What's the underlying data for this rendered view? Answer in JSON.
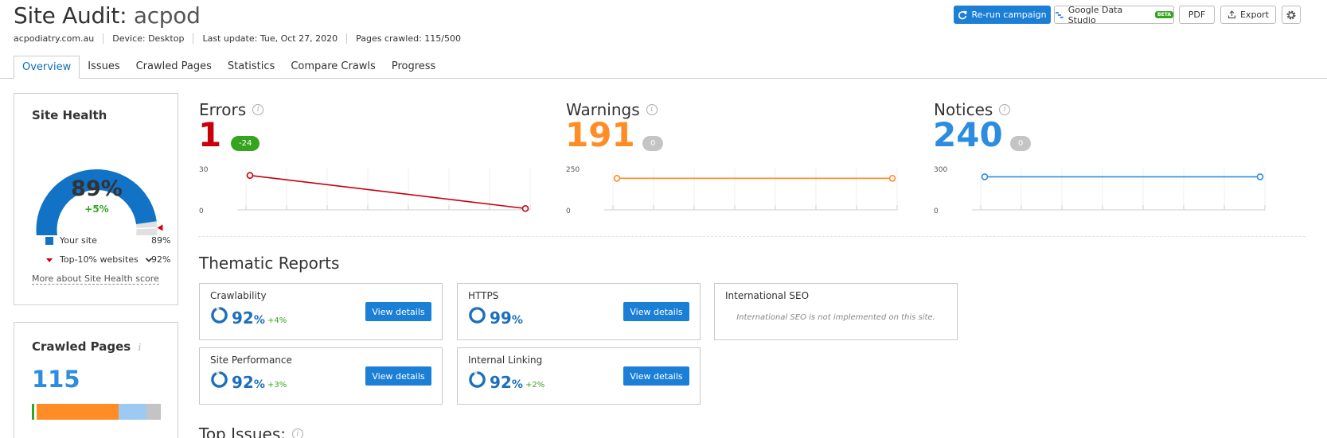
{
  "header": {
    "title": "Site Audit:",
    "project": "acpod",
    "meta": [
      "acpodiatry.com.au",
      "Device: Desktop",
      "Last update: Tue, Oct 27, 2020",
      "Pages crawled: 115/500"
    ]
  },
  "toolbar": {
    "rerun_label": "Re-run campaign",
    "gds_label": "Google Data Studio",
    "beta_label": "BETA",
    "pdf_label": "PDF",
    "export_label": "Export"
  },
  "tabs": [
    "Overview",
    "Issues",
    "Crawled Pages",
    "Statistics",
    "Compare Crawls",
    "Progress"
  ],
  "site_health": {
    "title": "Site Health",
    "value": "89%",
    "change": "+5%",
    "fraction": 0.89,
    "top10_fraction": 0.92,
    "legend": [
      {
        "label": "Your site",
        "value": "89%",
        "color": "#1172c6"
      },
      {
        "label": "Top-10% websites",
        "value": "92%",
        "color": "#d6000c"
      }
    ],
    "more_link": "More about Site Health score"
  },
  "crawled_pages": {
    "title": "Crawled Pages",
    "value": "115",
    "segments": [
      {
        "fraction": 0.02,
        "color": "#36a420"
      },
      {
        "fraction": 0.02,
        "color": "#ffffff"
      },
      {
        "fraction": 0.63,
        "color": "#ff8c25"
      },
      {
        "fraction": 0.22,
        "color": "#9dcaf2"
      },
      {
        "fraction": 0.11,
        "color": "#c4c4c4"
      }
    ]
  },
  "metrics": [
    {
      "name": "Errors",
      "value": "1",
      "badge": "-24",
      "color": "#c7000c",
      "badge_color": "#36a420",
      "ymax": "30",
      "ymin": "0",
      "ymax_num": 30,
      "points": [
        25,
        1
      ]
    },
    {
      "name": "Warnings",
      "value": "191",
      "badge": "0",
      "color": "#ff8c25",
      "badge_color": "#c4c4c4",
      "ymax": "250",
      "ymin": "0",
      "ymax_num": 250,
      "points": [
        191,
        191
      ]
    },
    {
      "name": "Notices",
      "value": "240",
      "badge": "0",
      "color": "#2c8de0",
      "badge_color": "#c4c4c4",
      "ymax": "300",
      "ymin": "0",
      "ymax_num": 300,
      "points": [
        240,
        240
      ]
    }
  ],
  "thematic": {
    "title": "Thematic Reports",
    "view_label": "View details",
    "reports": [
      {
        "name": "Crawlability",
        "pct": "92",
        "delta": "+4%",
        "fraction": 0.92
      },
      {
        "name": "HTTPS",
        "pct": "99",
        "delta": "",
        "fraction": 0.99
      },
      {
        "name": "International SEO",
        "note": "International SEO is not implemented on this site."
      },
      {
        "name": "Site Performance",
        "pct": "92",
        "delta": "+3%",
        "fraction": 0.92
      },
      {
        "name": "Internal Linking",
        "pct": "92",
        "delta": "+2%",
        "fraction": 0.92
      }
    ]
  },
  "top_issues": {
    "title": "Top Issues:"
  }
}
